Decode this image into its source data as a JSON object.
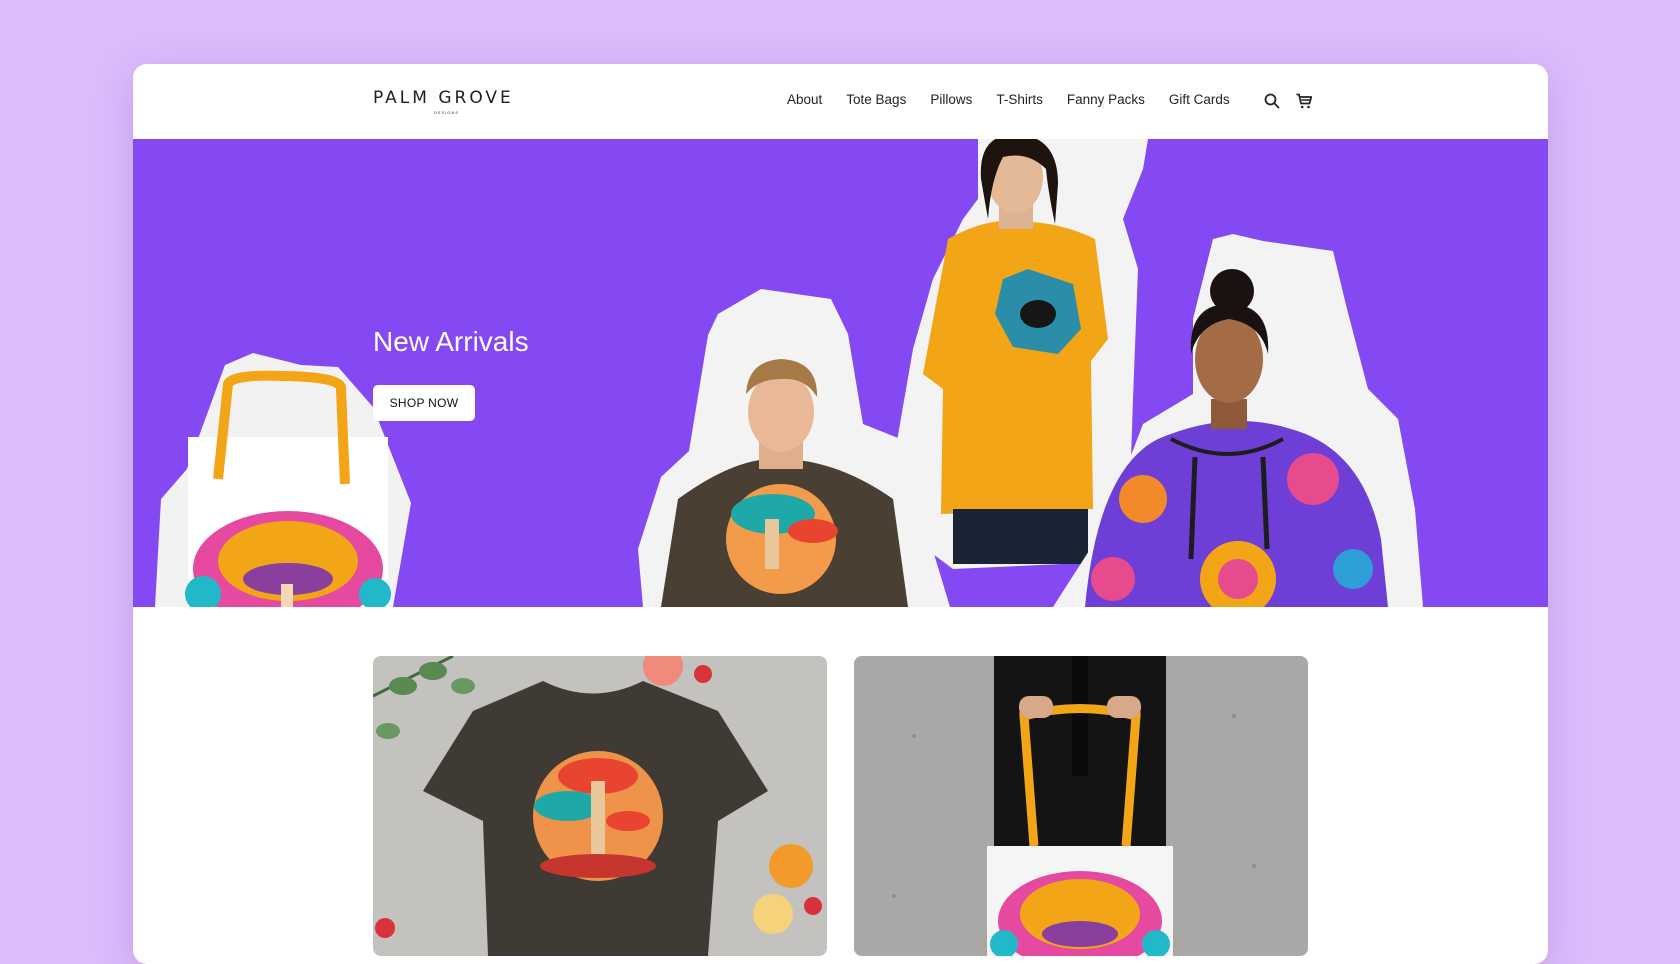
{
  "site": {
    "logo_text": "PALM GROVE",
    "logo_tagline": "DESIGNS"
  },
  "nav": {
    "items": [
      {
        "label": "About"
      },
      {
        "label": "Tote Bags"
      },
      {
        "label": "Pillows"
      },
      {
        "label": "T-Shirts"
      },
      {
        "label": "Fanny Packs"
      },
      {
        "label": "Gift Cards"
      }
    ],
    "icons": [
      "search-icon",
      "cart-icon"
    ]
  },
  "hero": {
    "title": "New Arrivals",
    "cta_label": "SHOP NOW"
  },
  "colors": {
    "page_background": "#dcbcfb",
    "hero_background": "#8449f2",
    "accent_yellow": "#f2a516"
  }
}
